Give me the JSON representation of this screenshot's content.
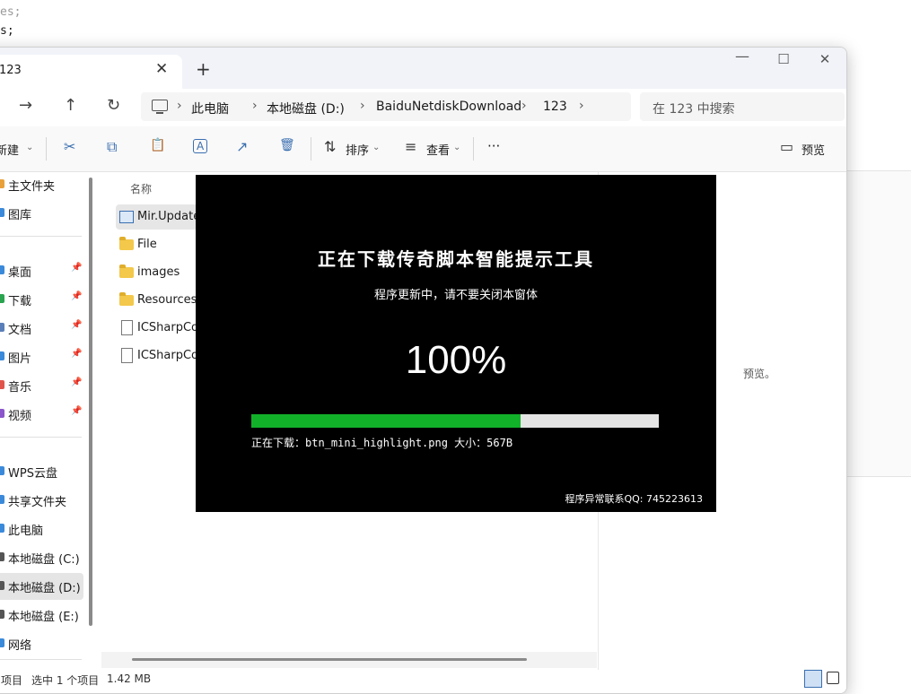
{
  "background_code": {
    "line1": "es;",
    "line2": "s;"
  },
  "window": {
    "tab_title": "123",
    "tab_close": "✕",
    "new_tab": "+",
    "controls": {
      "minimize": "—",
      "maximize": "☐",
      "close": "✕"
    }
  },
  "navigation": {
    "forward": "→",
    "up": "↑",
    "refresh": "↻"
  },
  "breadcrumb": {
    "items": [
      "此电脑",
      "本地磁盘 (D:)",
      "BaiduNetdiskDownload",
      "123"
    ],
    "separator": "›"
  },
  "search": {
    "placeholder": "在 123 中搜索"
  },
  "toolbar": {
    "new": "新建",
    "sort": "排序",
    "view": "查看",
    "more": "···",
    "preview": "预览",
    "icons": {
      "cut": "✂",
      "copy": "⧉",
      "paste": "📋",
      "rename": "A",
      "share": "↗",
      "delete": "🗑",
      "sort": "⇅",
      "view": "≡",
      "preview": "▭"
    }
  },
  "sidebar": {
    "items": [
      {
        "label": "主文件夹",
        "color": "#e8a13a"
      },
      {
        "label": "图库",
        "color": "#3b8ad9"
      },
      {
        "label": "桌面",
        "color": "#3b8ad9",
        "pinned": true
      },
      {
        "label": "下载",
        "color": "#2aa44f",
        "pinned": true
      },
      {
        "label": "文档",
        "color": "#5a7fb8",
        "pinned": true
      },
      {
        "label": "图片",
        "color": "#3b8ad9",
        "pinned": true
      },
      {
        "label": "音乐",
        "color": "#e0554b",
        "pinned": true
      },
      {
        "label": "视频",
        "color": "#8a56c9",
        "pinned": true
      },
      {
        "label": "WPS云盘",
        "color": "#3b8ad9"
      },
      {
        "label": "共享文件夹",
        "color": "#3b8ad9"
      },
      {
        "label": "此电脑",
        "color": "#3b8ad9"
      },
      {
        "label": "本地磁盘 (C:)",
        "color": "#555555"
      },
      {
        "label": "本地磁盘 (D:)",
        "color": "#555555",
        "selected": true
      },
      {
        "label": "本地磁盘 (E:)",
        "color": "#555555"
      },
      {
        "label": "网络",
        "color": "#3b8ad9"
      }
    ],
    "pin_glyph": "📌"
  },
  "content": {
    "column_name": "名称",
    "files": [
      {
        "name": "Mir.Update",
        "type": "exe",
        "selected": true
      },
      {
        "name": "File",
        "type": "folder"
      },
      {
        "name": "images",
        "type": "folder"
      },
      {
        "name": "Resources",
        "type": "folder"
      },
      {
        "name": "ICSharpCod",
        "type": "doc"
      },
      {
        "name": "ICSharpCod",
        "type": "doc"
      }
    ],
    "preview_hint": "预览。"
  },
  "status": {
    "count_suffix": "项目",
    "selection": "选中 1 个项目",
    "size": "1.42 MB"
  },
  "updater": {
    "title": "正在下载传奇脚本智能提示工具",
    "subtitle": "程序更新中，请不要关闭本窗体",
    "percent_text": "100%",
    "progress": 0.66,
    "file_line": "正在下载：btn_mini_highlight.png  大小：567B",
    "contact": "程序异常联系QQ: 745223613",
    "bar_color": "#12b12a"
  }
}
